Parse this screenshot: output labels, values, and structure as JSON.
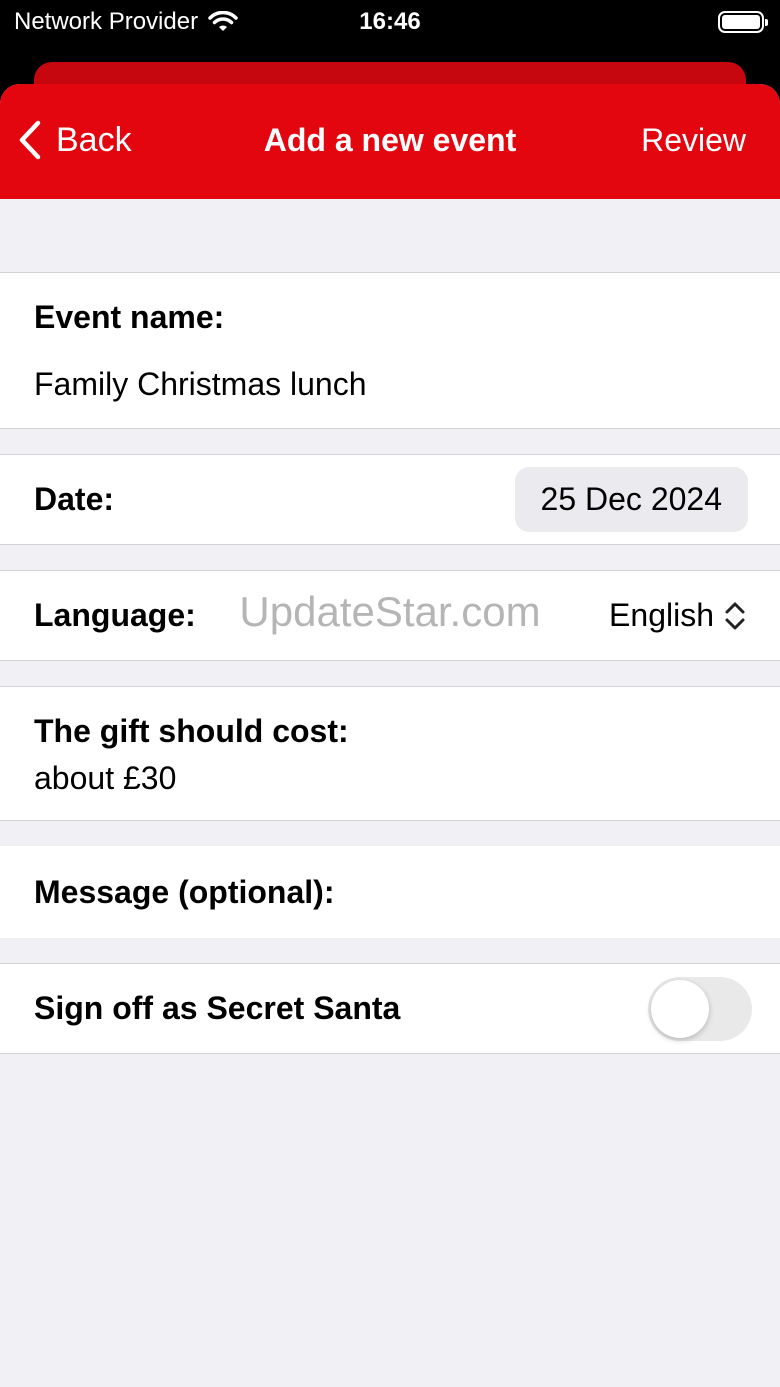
{
  "status_bar": {
    "carrier": "Network Provider",
    "time": "16:46"
  },
  "nav": {
    "back_label": "Back",
    "title": "Add a new event",
    "review_label": "Review"
  },
  "form": {
    "event_name_label": "Event name:",
    "event_name_value": "Family Christmas lunch",
    "date_label": "Date:",
    "date_value": "25 Dec 2024",
    "language_label": "Language:",
    "language_value": "English",
    "gift_cost_label": "The gift should cost:",
    "gift_cost_value": "about £30",
    "message_label": "Message (optional):",
    "secret_santa_label": "Sign off as Secret Santa",
    "secret_santa_enabled": false
  },
  "watermark": "UpdateStar.com",
  "colors": {
    "accent": "#e3060f",
    "background": "#f0f0f5"
  }
}
